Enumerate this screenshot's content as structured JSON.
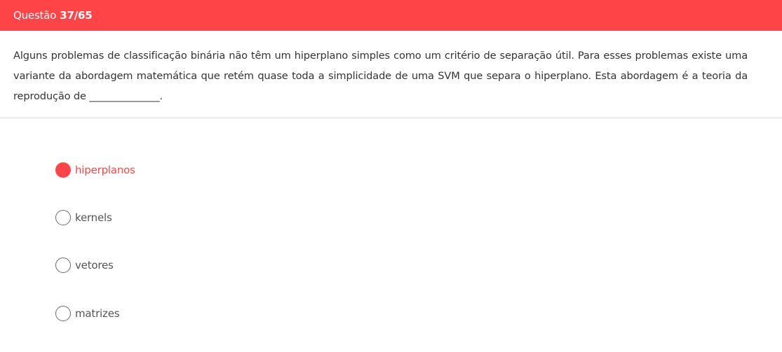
{
  "header": {
    "label": "Questão",
    "number": "37/65",
    "background": "#ff4447"
  },
  "question": {
    "text": "Alguns problemas de classificação binária não têm um hiperplano simples como um critério de separação útil. Para esses problemas existe uma variante da abordagem matemática que retém quase toda a simplicidade de uma SVM que separa o hiperplano. Esta abordagem é a teoria da reprodução de ______________."
  },
  "options": [
    {
      "label": "hiperplanos",
      "selected": true
    },
    {
      "label": "kernels",
      "selected": false
    },
    {
      "label": "vetores",
      "selected": false
    },
    {
      "label": "matrizes",
      "selected": false
    }
  ],
  "colors": {
    "accent": "#ff4447",
    "text": "#333333"
  }
}
